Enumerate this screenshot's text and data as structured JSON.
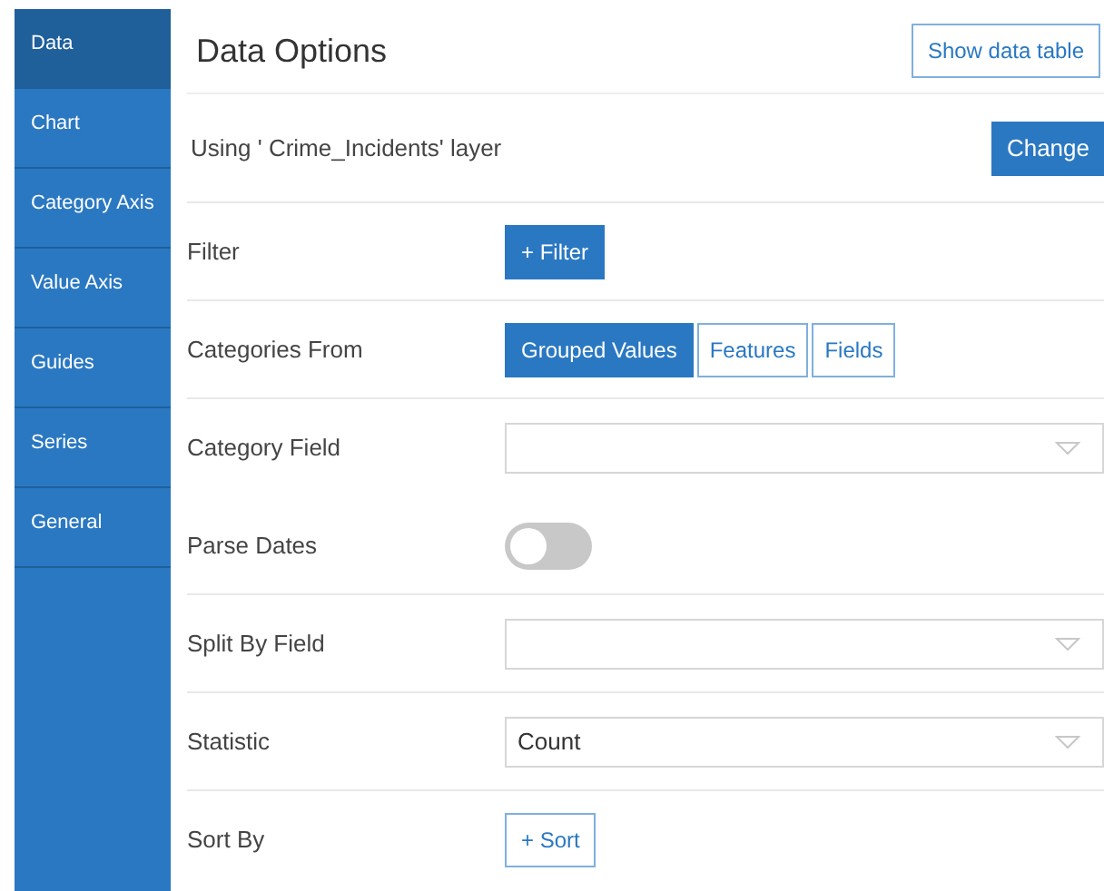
{
  "sidebar": {
    "items": [
      {
        "label": "Data",
        "selected": true
      },
      {
        "label": "Chart",
        "selected": false
      },
      {
        "label": "Category Axis",
        "selected": false
      },
      {
        "label": "Value Axis",
        "selected": false
      },
      {
        "label": "Guides",
        "selected": false
      },
      {
        "label": "Series",
        "selected": false
      },
      {
        "label": "General",
        "selected": false
      }
    ]
  },
  "header": {
    "title": "Data Options",
    "button": "Show data table"
  },
  "layer": {
    "text": "Using ' Crime_Incidents' layer",
    "button": "Change"
  },
  "rows": [
    {
      "kind": "button",
      "label": "Filter",
      "button": "+ Filter",
      "primary": true
    },
    {
      "kind": "segmented",
      "label": "Categories From",
      "options": [
        {
          "label": "Grouped Values",
          "selected": true
        },
        {
          "label": "Features",
          "selected": false
        },
        {
          "label": "Fields",
          "selected": false
        }
      ]
    },
    {
      "kind": "select",
      "label": "Category Field"
    },
    {
      "kind": "toggle",
      "label": "Parse Dates",
      "on": false
    },
    {
      "kind": "select",
      "label": "Split By Field"
    },
    {
      "kind": "select",
      "label": "Statistic",
      "value": "Count"
    },
    {
      "kind": "button",
      "label": "Sort By",
      "button": "+ Sort",
      "primary": false
    }
  ]
}
